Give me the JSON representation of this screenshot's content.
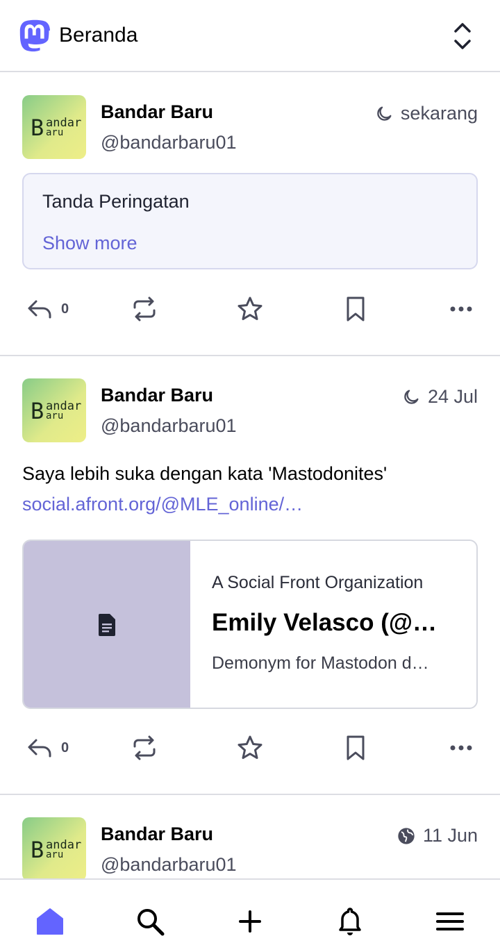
{
  "header": {
    "title": "Beranda"
  },
  "posts": [
    {
      "display_name": "Bandar Baru",
      "handle": "@bandarbaru01",
      "time": "sekarang",
      "cw_title": "Tanda Peringatan",
      "cw_more": "Show more",
      "reply_count": "0"
    },
    {
      "display_name": "Bandar Baru",
      "handle": "@bandarbaru01",
      "time": "24 Jul",
      "text": "Saya lebih suka dengan kata 'Mastodonites'",
      "link": "social.afront.org/@MLE_online/…",
      "card": {
        "site": "A Social Front Organization",
        "title": "Emily Velasco (@…",
        "description": "Demonym for Mastodon d…"
      },
      "reply_count": "0"
    },
    {
      "display_name": "Bandar Baru",
      "handle": "@bandarbaru01",
      "time": "11 Jun"
    }
  ],
  "avatar_text": {
    "b": "B",
    "andar": "andar",
    "aru": "aru"
  },
  "colors": {
    "accent": "#6364d6",
    "muted": "#4a4c5c",
    "nav_active": "#6364ff"
  },
  "icons": {
    "logo": "mastodon-logo-icon",
    "toggle": "chevron-up-down-icon",
    "visibility_unlisted": "moon-icon",
    "visibility_public": "globe-icon",
    "reply": "reply-icon",
    "boost": "boost-icon",
    "favourite": "star-icon",
    "bookmark": "bookmark-icon",
    "more": "more-icon",
    "card_thumb": "document-icon",
    "nav": [
      "home-icon",
      "search-icon",
      "plus-icon",
      "bell-icon",
      "menu-icon"
    ]
  }
}
